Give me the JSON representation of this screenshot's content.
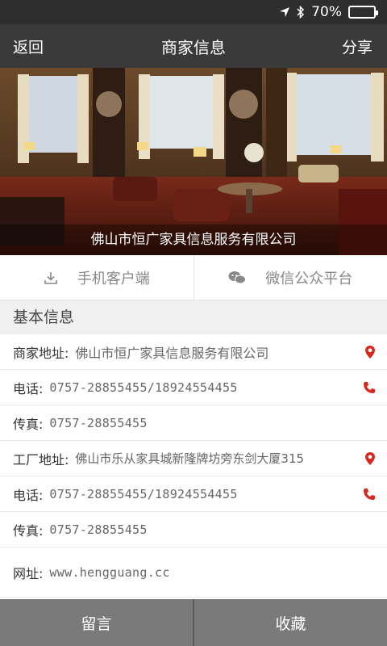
{
  "status_bar": {
    "battery": "70%",
    "battery_level": 0.7
  },
  "nav": {
    "back": "返回",
    "title": "商家信息",
    "share": "分享"
  },
  "hero": {
    "caption": "佛山市恒广家具信息服务有限公司"
  },
  "clients": {
    "mobile": "手机客户端",
    "wechat": "微信公众平台"
  },
  "section": {
    "title": "基本信息"
  },
  "info": {
    "shop_address_label": "商家地址:",
    "shop_address": "佛山市恒广家具信息服务有限公司",
    "phone1_label": "电话:",
    "phone1": "0757-28855455/18924554455",
    "fax1_label": "传真:",
    "fax1": "0757-28855455",
    "factory_address_label": "工厂地址:",
    "factory_address": "佛山市乐从家具城新隆牌坊旁东剑大厦315",
    "phone2_label": "电话:",
    "phone2": "0757-28855455/18924554455",
    "fax2_label": "传真:",
    "fax2": "0757-28855455",
    "website_label": "网址:",
    "website": "www.hengguang.cc"
  },
  "actions": {
    "message": "留言",
    "favorite": "收藏"
  },
  "colors": {
    "accent_red": "#d8281e",
    "nav_bg": "#3a3a3a",
    "status_bg": "#2e2e2e"
  }
}
